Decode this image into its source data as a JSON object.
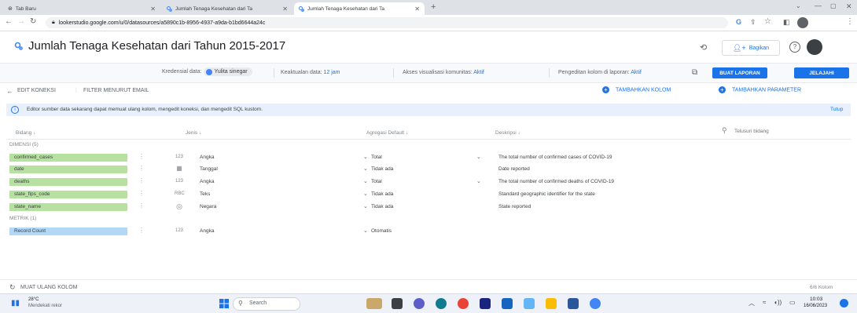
{
  "browser": {
    "tabs": [
      {
        "label": "Tab Baru"
      },
      {
        "label": "Jumlah Tenaga Kesehatan dari Ta"
      },
      {
        "label": "Jumlah Tenaga Kesehatan dari Ta"
      }
    ],
    "url": "lookerstudio.google.com/u/0/datasources/a5890c1b-8956-4937-a9da-b1bd6644a24c"
  },
  "header": {
    "title": "Jumlah Tenaga Kesehatan dari Tahun 2015-2017",
    "share_label": "Bagikan"
  },
  "toolbar": {
    "credentials_label": "Kredensial data:",
    "credentials_user": "Yulita sinegar",
    "freshness_label": "Keaktualan data:",
    "freshness_value": "12 jam",
    "community_label": "Akses visualisasi komunitas:",
    "community_value": "Aktif",
    "field_edit_label": "Pengeditan kolom di laporan:",
    "field_edit_value": "Aktif",
    "create_report": "BUAT LAPORAN",
    "explore": "JELAJAHI"
  },
  "subbar": {
    "edit_connection": "EDIT KONEKSI",
    "filter_email": "FILTER MENURUT EMAIL",
    "add_field": "TAMBAHKAN KOLOM",
    "add_parameter": "TAMBAHKAN PARAMETER"
  },
  "banner": {
    "text": "Editor sumber data sekarang dapat memuat ulang kolom, mengedit koneksi, dan mengedit SQL kustom.",
    "close": "Tutup"
  },
  "columns": {
    "field": "Bidang",
    "type": "Jenis",
    "aggregation": "Agregasi Default",
    "description": "Deskripsi",
    "search_placeholder": "Telusuri bidang"
  },
  "dimensions": {
    "label": "DIMENSI (5)",
    "rows": [
      {
        "name": "confirmed_cases",
        "type_icon": "123",
        "type": "Angka",
        "agg": "Total",
        "desc": "The total number of confirmed cases of COVID-19"
      },
      {
        "name": "date",
        "type_icon": "▦",
        "type": "Tanggal",
        "agg": "Tidak ada",
        "desc": "Date reported"
      },
      {
        "name": "deaths",
        "type_icon": "123",
        "type": "Angka",
        "agg": "Total",
        "desc": "The total number of confirmed deaths of COVID-19"
      },
      {
        "name": "state_fips_code",
        "type_icon": "RBC",
        "type": "Teks",
        "agg": "Tidak ada",
        "desc": "Standard geographic identifier for the state"
      },
      {
        "name": "state_name",
        "type_icon": "◎",
        "type": "Negara",
        "agg": "Tidak ada",
        "desc": "State reported"
      }
    ]
  },
  "metrics": {
    "label": "METRIK (1)",
    "rows": [
      {
        "name": "Record Count",
        "type_icon": "123",
        "type": "Angka",
        "agg": "Otomatis",
        "desc": ""
      }
    ]
  },
  "footer": {
    "reload": "MUAT ULANG KOLOM",
    "count": "6/6 Kolom"
  },
  "taskbar": {
    "temp": "28°C",
    "weather": "Mendekati rekor",
    "search": "Search",
    "time": "10:03",
    "date": "16/06/2023"
  },
  "colors": {
    "dimension": "#b7e1a1",
    "metric": "#b3d7f7",
    "accent": "#1a73e8"
  }
}
